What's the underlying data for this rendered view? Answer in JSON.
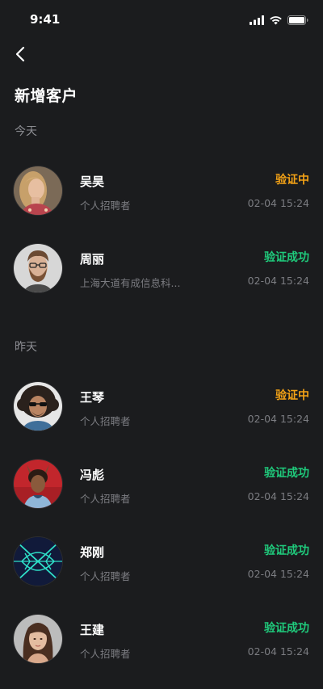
{
  "status_bar": {
    "time": "9:41",
    "icons": [
      "cellular-signal-icon",
      "wifi-icon",
      "battery-icon"
    ]
  },
  "header": {
    "back_icon": "chevron-left-icon",
    "title": "新增客户"
  },
  "sections": [
    {
      "label": "今天",
      "items": [
        {
          "name": "吴昊",
          "subtitle": "个人招聘者",
          "status": "验证中",
          "status_type": "pending",
          "time": "02-04 15:24"
        },
        {
          "name": "周丽",
          "subtitle": "上海大道有成信息科...",
          "status": "验证成功",
          "status_type": "success",
          "time": "02-04 15:24"
        }
      ]
    },
    {
      "label": "昨天",
      "items": [
        {
          "name": "王琴",
          "subtitle": "个人招聘者",
          "status": "验证中",
          "status_type": "pending",
          "time": "02-04 15:24"
        },
        {
          "name": "冯彪",
          "subtitle": "个人招聘者",
          "status": "验证成功",
          "status_type": "success",
          "time": "02-04 15:24"
        },
        {
          "name": "郑刚",
          "subtitle": "个人招聘者",
          "status": "验证成功",
          "status_type": "success",
          "time": "02-04 15:24"
        },
        {
          "name": "王建",
          "subtitle": "个人招聘者",
          "status": "验证成功",
          "status_type": "success",
          "time": "02-04 15:24"
        }
      ]
    }
  ],
  "colors": {
    "background": "#1b1c1e",
    "pending": "#f2a116",
    "success": "#1fcb7c",
    "secondary_text": "#7b7c81"
  }
}
